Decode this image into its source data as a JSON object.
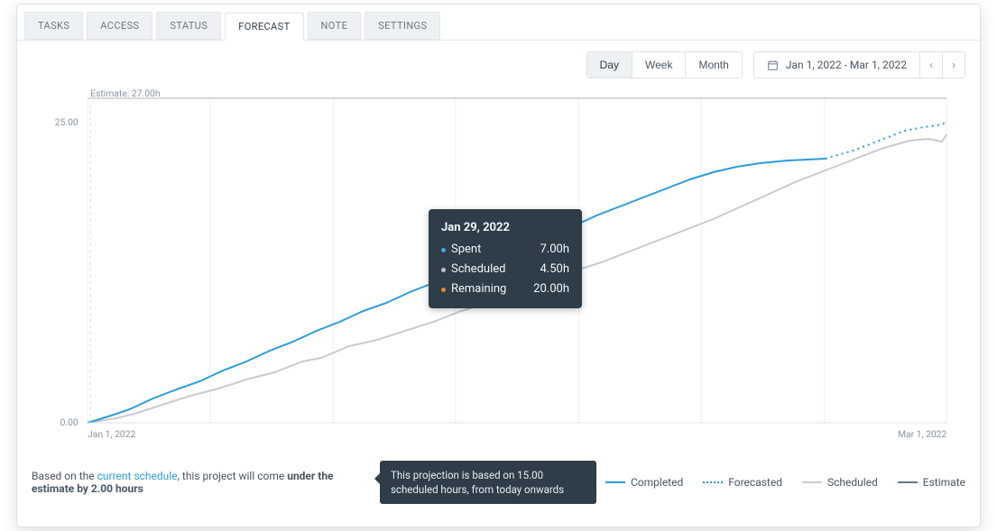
{
  "tabs": {
    "items": [
      "TASKS",
      "ACCESS",
      "STATUS",
      "FORECAST",
      "NOTE",
      "SETTINGS"
    ],
    "active_index": 3
  },
  "toolbar": {
    "granularity": {
      "options": [
        "Day",
        "Week",
        "Month"
      ],
      "active_index": 0
    },
    "date_range_label": "Jan 1, 2022 - Mar 1, 2022"
  },
  "chart": {
    "estimate_label": "Estimate: 27.00h",
    "y_axis_ticks": [
      "0.00",
      "25.00"
    ],
    "x_axis_start": "Jan 1, 2022",
    "x_axis_end": "Mar 1, 2022"
  },
  "tooltip": {
    "title": "Jan 29, 2022",
    "rows": [
      {
        "label": "Spent",
        "value": "7.00h",
        "color": "blue"
      },
      {
        "label": "Scheduled",
        "value": "4.50h",
        "color": "grey"
      },
      {
        "label": "Remaining",
        "value": "20.00h",
        "color": "orange"
      }
    ]
  },
  "footer": {
    "text_prefix": "Based on the ",
    "link_text": "current schedule",
    "text_mid": ", this project will come ",
    "bold_text": "under the estimate by 2.00 hours",
    "projection_note": "This projection is based on 15.00 scheduled hours, from today onwards"
  },
  "legend": {
    "completed": "Completed",
    "forecasted": "Forecasted",
    "scheduled": "Scheduled",
    "estimate": "Estimate"
  },
  "chart_data": {
    "type": "line",
    "title": "",
    "xlabel": "",
    "ylabel": "",
    "ylim": [
      0,
      27
    ],
    "x_range": [
      "2022-01-01",
      "2022-03-01"
    ],
    "estimate_value": 27.0,
    "series": [
      {
        "name": "Completed",
        "style": "solid",
        "color": "#2d9cdb",
        "x": [
          "2022-01-01",
          "2022-01-15",
          "2022-01-29",
          "2022-02-12",
          "2022-02-21"
        ],
        "values": [
          0.0,
          5.5,
          12.5,
          19.5,
          22.0
        ]
      },
      {
        "name": "Scheduled",
        "style": "solid",
        "color": "#c6ccd2",
        "x": [
          "2022-01-01",
          "2022-01-15",
          "2022-01-29",
          "2022-02-12",
          "2022-02-26",
          "2022-03-01"
        ],
        "values": [
          0.0,
          4.5,
          10.5,
          17.0,
          22.5,
          24.0
        ]
      },
      {
        "name": "Forecasted",
        "style": "dotted",
        "color": "#2d9cdb",
        "x": [
          "2022-02-21",
          "2022-03-01"
        ],
        "values": [
          22.0,
          25.0
        ]
      },
      {
        "name": "Estimate",
        "style": "solid",
        "color": "#6b7682",
        "x": [
          "2022-01-01",
          "2022-03-01"
        ],
        "values": [
          27.0,
          27.0
        ]
      }
    ]
  }
}
